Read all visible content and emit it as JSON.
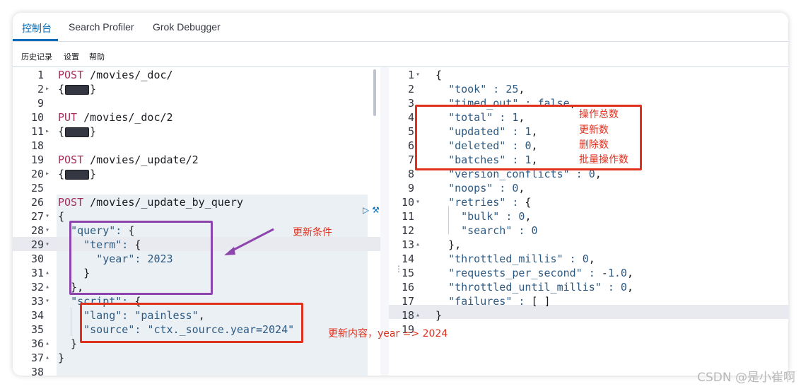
{
  "tabs": [
    "控制台",
    "Search Profiler",
    "Grok Debugger"
  ],
  "toolbar": [
    "历史记录",
    "设置",
    "帮助"
  ],
  "request_lines": [
    {
      "n": "1",
      "fold": "",
      "method": "POST",
      "url": " /movies/_doc/"
    },
    {
      "n": "2",
      "fold": "▸",
      "collapsed": true
    },
    {
      "n": "9",
      "fold": ""
    },
    {
      "n": "10",
      "fold": "",
      "method": "PUT",
      "url": " /movies/_doc/2"
    },
    {
      "n": "11",
      "fold": "▸",
      "collapsed": true
    },
    {
      "n": "18",
      "fold": ""
    },
    {
      "n": "19",
      "fold": "",
      "method": "POST",
      "url": " /movies/_update/2"
    },
    {
      "n": "20",
      "fold": "▸",
      "collapsed": true
    },
    {
      "n": "25",
      "fold": ""
    },
    {
      "n": "26",
      "fold": "",
      "method": "POST",
      "url": " /movies/_update_by_query"
    },
    {
      "n": "27",
      "fold": "▾",
      "text": "{"
    },
    {
      "n": "28",
      "fold": "▾",
      "text": "  \"query\": {"
    },
    {
      "n": "29",
      "fold": "▾",
      "text": "    \"term\": {"
    },
    {
      "n": "30",
      "fold": "",
      "text": "      \"year\": 2023"
    },
    {
      "n": "31",
      "fold": "▴",
      "text": "    }"
    },
    {
      "n": "32",
      "fold": "▴",
      "text": "  },"
    },
    {
      "n": "33",
      "fold": "▾",
      "text": "  \"script\": {"
    },
    {
      "n": "34",
      "fold": "",
      "text": "    \"lang\": \"painless\","
    },
    {
      "n": "35",
      "fold": "",
      "text": "    \"source\": \"ctx._source.year=2024\""
    },
    {
      "n": "36",
      "fold": "▴",
      "text": "  }"
    },
    {
      "n": "37",
      "fold": "▴",
      "text": "}"
    },
    {
      "n": "38",
      "fold": "",
      "text": ""
    }
  ],
  "response_lines": [
    {
      "n": "1",
      "fold": "▾",
      "text": "{"
    },
    {
      "n": "2",
      "fold": "",
      "text": "  \"took\" : 25,"
    },
    {
      "n": "3",
      "fold": "",
      "text": "  \"timed_out\" : false,"
    },
    {
      "n": "4",
      "fold": "",
      "text": "  \"total\" : 1,"
    },
    {
      "n": "5",
      "fold": "",
      "text": "  \"updated\" : 1,"
    },
    {
      "n": "6",
      "fold": "",
      "text": "  \"deleted\" : 0,"
    },
    {
      "n": "7",
      "fold": "",
      "text": "  \"batches\" : 1,"
    },
    {
      "n": "8",
      "fold": "",
      "text": "  \"version_conflicts\" : 0,"
    },
    {
      "n": "9",
      "fold": "",
      "text": "  \"noops\" : 0,"
    },
    {
      "n": "10",
      "fold": "▾",
      "text": "  \"retries\" : {"
    },
    {
      "n": "11",
      "fold": "",
      "text": "    \"bulk\" : 0,"
    },
    {
      "n": "12",
      "fold": "",
      "text": "    \"search\" : 0"
    },
    {
      "n": "13",
      "fold": "▴",
      "text": "  },"
    },
    {
      "n": "14",
      "fold": "",
      "text": "  \"throttled_millis\" : 0,"
    },
    {
      "n": "15",
      "fold": "",
      "text": "  \"requests_per_second\" : -1.0,"
    },
    {
      "n": "16",
      "fold": "",
      "text": "  \"throttled_until_millis\" : 0,"
    },
    {
      "n": "17",
      "fold": "",
      "text": "  \"failures\" : [ ]"
    },
    {
      "n": "18",
      "fold": "▴",
      "text": "}"
    },
    {
      "n": "19",
      "fold": "",
      "text": ""
    }
  ],
  "annotations": {
    "total": "操作总数",
    "updated": "更新数",
    "deleted": "删除数",
    "batches": "批量操作数",
    "query_condition": "更新条件",
    "update_content": "更新内容，year => 2024"
  },
  "watermark": "CSDN @是小崔啊",
  "colors": {
    "accent": "#006bb8",
    "method": "#a42e5b",
    "json": "#2d5a83",
    "red_box": "#e0301e",
    "purple_box": "#8e44ad"
  }
}
